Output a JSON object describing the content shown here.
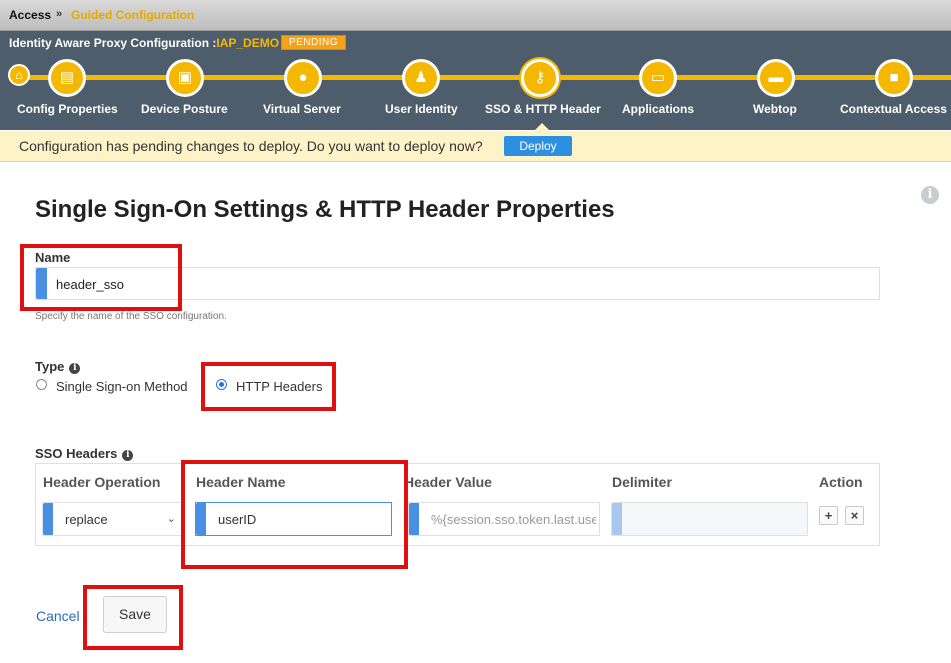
{
  "breadcrumb": {
    "root": "Access",
    "separator": "»",
    "current": "Guided Configuration"
  },
  "wizard": {
    "title_prefix": "Identity Aware Proxy Configuration :",
    "title_name": "IAP_DEMO",
    "status_badge": "PENDING",
    "steps": [
      {
        "label": "Config Properties",
        "icon": "document-icon"
      },
      {
        "label": "Device Posture",
        "icon": "id-card-icon"
      },
      {
        "label": "Virtual Server",
        "icon": "globe-icon"
      },
      {
        "label": "User Identity",
        "icon": "users-icon"
      },
      {
        "label": "SSO & HTTP Header",
        "icon": "key-icon",
        "active": true
      },
      {
        "label": "Applications",
        "icon": "window-icon"
      },
      {
        "label": "Webtop",
        "icon": "monitor-icon"
      },
      {
        "label": "Contextual Access",
        "icon": "lock-icon"
      }
    ]
  },
  "notice": {
    "text": "Configuration has pending changes to deploy. Do you want to deploy now?",
    "deploy_label": "Deploy"
  },
  "page": {
    "title": "Single Sign-On Settings & HTTP Header Properties"
  },
  "name_field": {
    "label": "Name",
    "value": "header_sso",
    "hint": "Specify the name of the SSO configuration."
  },
  "type_field": {
    "label": "Type",
    "options": [
      {
        "label": "Single Sign-on Method",
        "selected": false
      },
      {
        "label": "HTTP Headers",
        "selected": true
      }
    ]
  },
  "sso_headers": {
    "label": "SSO Headers",
    "columns": [
      "Header Operation",
      "Header Name",
      "Header Value",
      "Delimiter",
      "Action"
    ],
    "row": {
      "operation": "replace",
      "header_name": "userID",
      "header_value": "%{session.sso.token.last.username}",
      "delimiter": ""
    },
    "add_symbol": "+",
    "remove_symbol": "×"
  },
  "footer": {
    "cancel_label": "Cancel",
    "save_label": "Save"
  },
  "colors": {
    "accent_blue": "#4a90e2",
    "wizard_yellow": "#f5b800",
    "wizard_bg": "#4e5d6b",
    "highlight_red": "#e01010"
  }
}
